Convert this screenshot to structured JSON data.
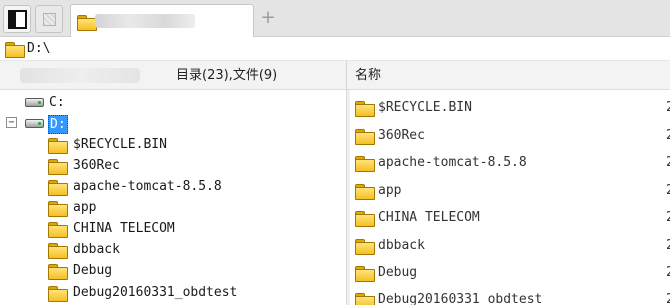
{
  "tabbar": {
    "panel_icon": "sidebar-toggle-icon",
    "blank_icon": "blank-page-icon",
    "active_tab_icon": "folder-icon",
    "add_tab_label": "+"
  },
  "address": {
    "path": "D:\\"
  },
  "header": {
    "summary": "目录(23),文件(9)",
    "name_column": "名称"
  },
  "tree": {
    "drives": [
      {
        "label": "C:",
        "icon": "drive-icon"
      },
      {
        "label": "D:",
        "icon": "drive-icon",
        "expander": "−",
        "selected": true
      }
    ],
    "folders": [
      "$RECYCLE.BIN",
      "360Rec",
      "apache-tomcat-8.5.8",
      "app",
      "CHINA TELECOM",
      "dbback",
      "Debug",
      "Debug20160331_obdtest"
    ]
  },
  "list": {
    "items": [
      {
        "name": "$RECYCLE.BIN",
        "extra": "2"
      },
      {
        "name": "360Rec",
        "extra": "2"
      },
      {
        "name": "apache-tomcat-8.5.8",
        "extra": "2"
      },
      {
        "name": "app",
        "extra": "2"
      },
      {
        "name": "CHINA TELECOM",
        "extra": "2"
      },
      {
        "name": "dbback",
        "extra": "2"
      },
      {
        "name": "Debug",
        "extra": "2"
      },
      {
        "name": "Debug20160331_obdtest",
        "extra": "2"
      }
    ]
  },
  "colors": {
    "selection": "#3399ff",
    "folder": "#f6bf22",
    "tabbar_bg": "#e4e4e4"
  }
}
